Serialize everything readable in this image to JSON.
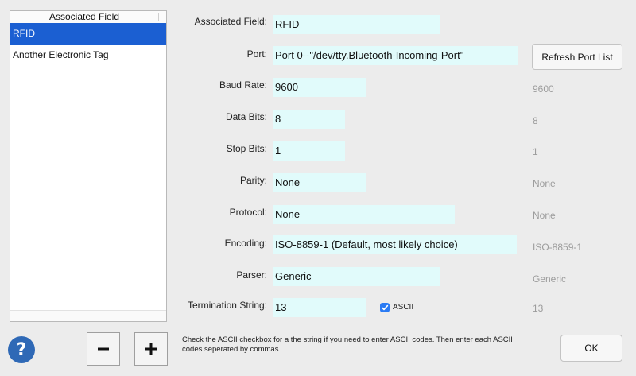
{
  "list": {
    "header": "Associated Field",
    "items": [
      {
        "label": "RFID",
        "selected": true
      },
      {
        "label": "Another Electronic Tag",
        "selected": false
      }
    ]
  },
  "form": {
    "associated_field": {
      "label": "Associated Field:",
      "value": "RFID"
    },
    "port": {
      "label": "Port:",
      "value": "Port 0--\"/dev/tty.Bluetooth-Incoming-Port\""
    },
    "baud_rate": {
      "label": "Baud Rate:",
      "value": "9600",
      "default": "9600"
    },
    "data_bits": {
      "label": "Data Bits:",
      "value": "8",
      "default": "8"
    },
    "stop_bits": {
      "label": "Stop Bits:",
      "value": "1",
      "default": "1"
    },
    "parity": {
      "label": "Parity:",
      "value": "None",
      "default": "None"
    },
    "protocol": {
      "label": "Protocol:",
      "value": "None",
      "default": "None"
    },
    "encoding": {
      "label": "Encoding:",
      "value": "ISO-8859-1 (Default, most likely choice)",
      "default": "ISO-8859-1"
    },
    "parser": {
      "label": "Parser:",
      "value": "Generic",
      "default": "Generic"
    },
    "termination": {
      "label": "Termination String:",
      "value": "13",
      "default": "13",
      "ascii_label": "ASCII",
      "ascii_checked": true
    }
  },
  "buttons": {
    "refresh": "Refresh Port List",
    "ok": "OK",
    "help": "?"
  },
  "hint": "Check the ASCII checkbox for a the string if you need to enter ASCII codes. Then enter each ASCII codes seperated by commas.",
  "colors": {
    "field_bg": "#e1fbfb",
    "selection": "#1b5fd2",
    "help": "#2f69b6",
    "checkbox": "#2a7bf4"
  }
}
